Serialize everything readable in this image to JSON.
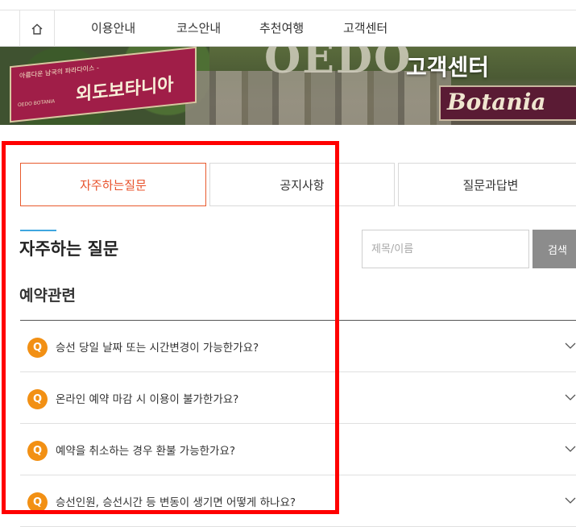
{
  "nav": {
    "home_icon": "home-icon",
    "items": [
      "이용안내",
      "코스안내",
      "추천여행",
      "고객센터"
    ]
  },
  "banner": {
    "title": "고객센터",
    "sign_small": "아름다운 남국의 파라다이스 -",
    "sign_big": "외도보타니아",
    "sign_logo": "OEDO BOTANIA",
    "big_letters": "OEDO",
    "botania": "Botania"
  },
  "tabs": [
    {
      "label": "자주하는질문",
      "active": true
    },
    {
      "label": "공지사항",
      "active": false
    },
    {
      "label": "질문과답변",
      "active": false
    }
  ],
  "page_title": "자주하는 질문",
  "search": {
    "placeholder": "제목/이름",
    "value": "",
    "button_label": "검색"
  },
  "category": "예약관련",
  "faq": {
    "q_badge": "Q",
    "items": [
      "승선 당일 날짜 또는 시간변경이 가능한가요?",
      "온라인 예약 마감 시 이용이 불가한가요?",
      "예약을 취소하는 경우 환불 가능한가요?",
      "승선인원, 승선시간 등 변동이 생기면 어떻게 하나요?"
    ]
  },
  "colors": {
    "accent_orange": "#e8502a",
    "q_badge": "#f29014",
    "title_bar": "#3fa6df",
    "search_button": "#8c8c8c",
    "highlight": "#ff0000"
  }
}
